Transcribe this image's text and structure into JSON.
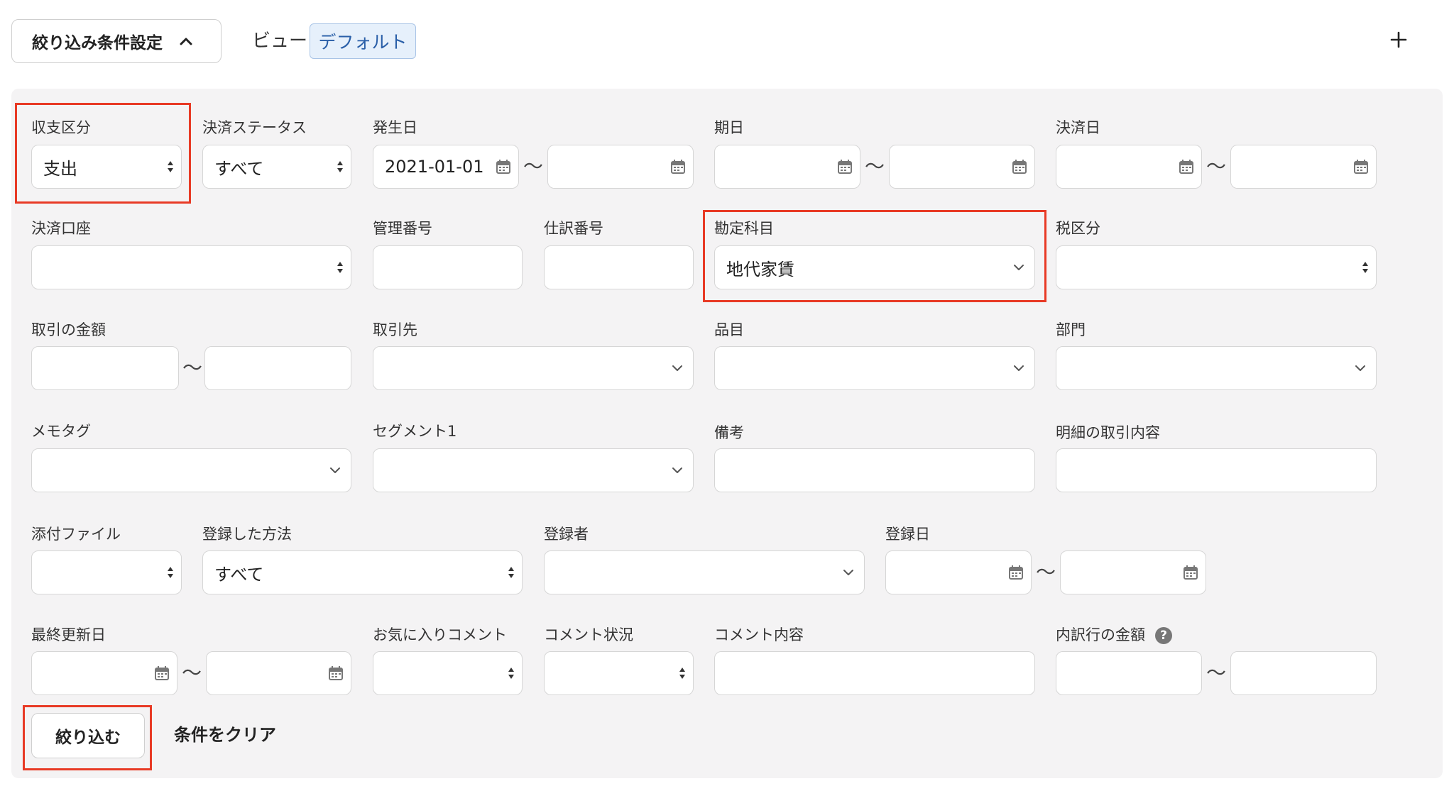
{
  "toolbar": {
    "filter_toggle_label": "絞り込み条件設定",
    "view_label": "ビュー",
    "view_value": "デフォルト",
    "add_label": "+"
  },
  "filters": {
    "income_type": {
      "label": "収支区分",
      "value": "支出"
    },
    "settlement_status": {
      "label": "決済ステータス",
      "value": "すべて"
    },
    "occurrence_date": {
      "label": "発生日",
      "from": "2021-01-01",
      "to": ""
    },
    "due_date": {
      "label": "期日",
      "from": "",
      "to": ""
    },
    "settlement_date": {
      "label": "決済日",
      "from": "",
      "to": ""
    },
    "settlement_account": {
      "label": "決済口座",
      "value": ""
    },
    "management_number": {
      "label": "管理番号",
      "value": ""
    },
    "journal_number": {
      "label": "仕訳番号",
      "value": ""
    },
    "account_item": {
      "label": "勘定科目",
      "value": "地代家賃"
    },
    "tax_category": {
      "label": "税区分",
      "value": ""
    },
    "amount": {
      "label": "取引の金額",
      "from": "",
      "to": ""
    },
    "partner": {
      "label": "取引先",
      "value": ""
    },
    "item": {
      "label": "品目",
      "value": ""
    },
    "department": {
      "label": "部門",
      "value": ""
    },
    "memo_tag": {
      "label": "メモタグ",
      "value": ""
    },
    "segment1": {
      "label": "セグメント1",
      "value": ""
    },
    "remarks": {
      "label": "備考",
      "value": ""
    },
    "detail_content": {
      "label": "明細の取引内容",
      "value": ""
    },
    "attachment": {
      "label": "添付ファイル",
      "value": ""
    },
    "registration_method": {
      "label": "登録した方法",
      "value": "すべて"
    },
    "registrant": {
      "label": "登録者",
      "value": ""
    },
    "registration_date": {
      "label": "登録日",
      "from": "",
      "to": ""
    },
    "last_updated": {
      "label": "最終更新日",
      "from": "",
      "to": ""
    },
    "favorite_comment": {
      "label": "お気に入りコメント",
      "value": ""
    },
    "comment_status": {
      "label": "コメント状況",
      "value": ""
    },
    "comment_content": {
      "label": "コメント内容",
      "value": ""
    },
    "line_amount": {
      "label": "内訳行の金額",
      "help": "?",
      "from": "",
      "to": ""
    }
  },
  "actions": {
    "filter_label": "絞り込む",
    "clear_label": "条件をクリア"
  },
  "colors": {
    "highlight": "#e83a25",
    "panel_bg": "#f4f3f4",
    "chip_bg": "#e6f0fb",
    "chip_text": "#2a5fa8"
  }
}
